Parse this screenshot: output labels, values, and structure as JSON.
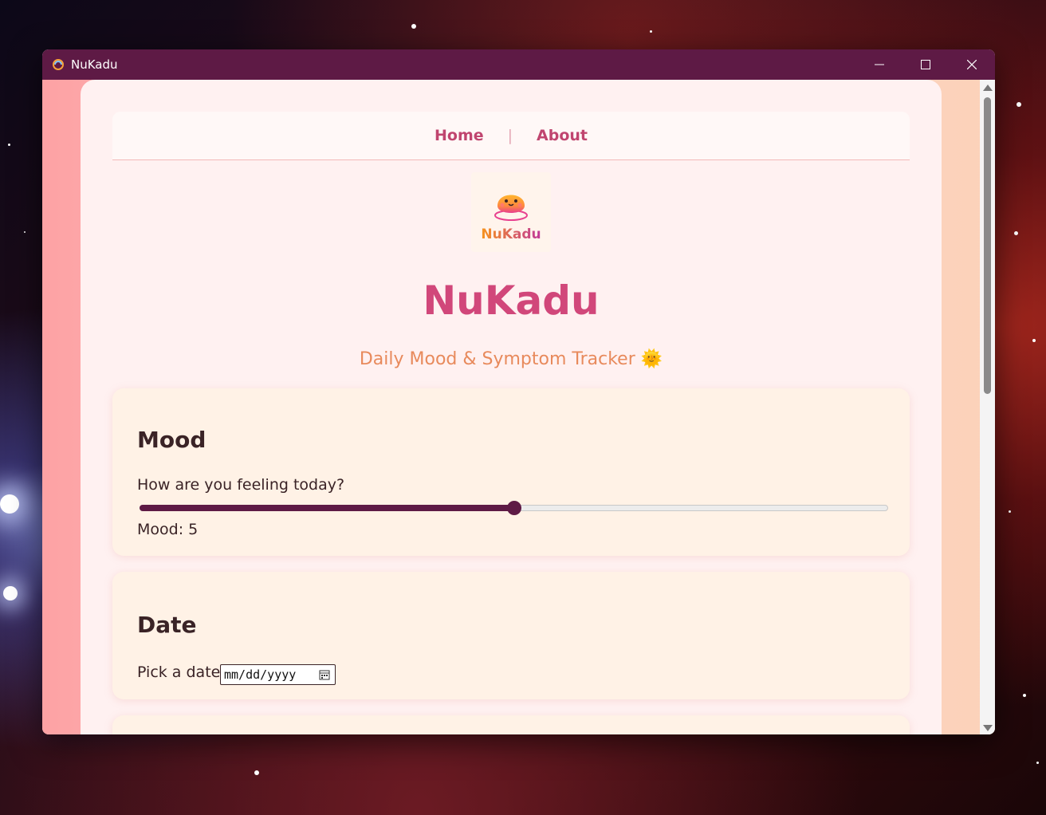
{
  "window": {
    "title": "NuKadu"
  },
  "nav": {
    "home": "Home",
    "separator": "|",
    "about": "About"
  },
  "logo": {
    "text": "NuKadu"
  },
  "header": {
    "app_name": "NuKadu",
    "tagline": "Daily Mood & Symptom Tracker 🌞"
  },
  "mood": {
    "heading": "Mood",
    "question": "How are you feeling today?",
    "value_label": "Mood: 5",
    "slider_min": 0,
    "slider_max": 10,
    "slider_value": 5
  },
  "date": {
    "heading": "Date",
    "label": "Pick a date:",
    "placeholder": "mm/dd/yyyy"
  },
  "colors": {
    "titlebar": "#5e1a45",
    "accent": "#d1477a",
    "nav_link": "#c0456f",
    "tagline": "#e88a5c",
    "card_bg": "#fff2e6",
    "slider_fill": "#5e1a45"
  }
}
